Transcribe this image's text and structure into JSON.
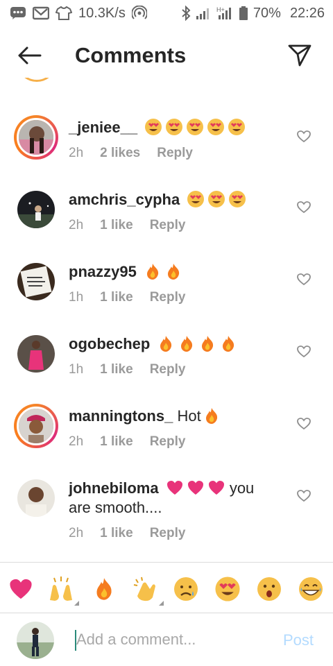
{
  "status_bar": {
    "speed": "10.3K/s",
    "battery": "70%",
    "time": "22:26",
    "network_label": "H+"
  },
  "header": {
    "title": "Comments",
    "back_icon": "arrow-left-icon",
    "share_icon": "paper-plane-icon"
  },
  "colors": {
    "story_ring": "#dd2a7b",
    "muted_text": "#9a9a9a",
    "post_disabled": "#b3dbff",
    "caret": "#2a8a7a"
  },
  "comments": [
    {
      "username": "_jeniee__",
      "text": "",
      "emojis": [
        "heart-eyes",
        "heart-eyes",
        "heart-eyes",
        "heart-eyes",
        "heart-eyes"
      ],
      "time": "2h",
      "likes": "2 likes",
      "reply": "Reply",
      "ring": true
    },
    {
      "username": "amchris_cypha",
      "text": "",
      "emojis": [
        "heart-eyes",
        "heart-eyes",
        "heart-eyes"
      ],
      "time": "2h",
      "likes": "1 like",
      "reply": "Reply",
      "ring": false
    },
    {
      "username": "pnazzy95",
      "text": "",
      "emojis": [
        "fire",
        "fire"
      ],
      "time": "1h",
      "likes": "1 like",
      "reply": "Reply",
      "ring": false
    },
    {
      "username": "ogobechep",
      "text": "",
      "emojis": [
        "fire",
        "fire",
        "fire",
        "fire"
      ],
      "time": "1h",
      "likes": "1 like",
      "reply": "Reply",
      "ring": false
    },
    {
      "username": "manningtons_",
      "text": "Hot",
      "emojis": [
        "fire"
      ],
      "time": "2h",
      "likes": "1 like",
      "reply": "Reply",
      "ring": true
    },
    {
      "username": "johnebiloma",
      "text_line1_after": "you",
      "text_line2": "are smooth....",
      "emojis": [
        "heart",
        "heart",
        "heart"
      ],
      "time": "2h",
      "likes": "1 like",
      "reply": "Reply",
      "ring": false
    }
  ],
  "quick_emojis": [
    "heart",
    "raised-hands",
    "fire",
    "clapping-hands",
    "sad-face",
    "heart-eyes",
    "surprised-face",
    "grinning-face"
  ],
  "composer": {
    "placeholder": "Add a comment...",
    "post_label": "Post"
  }
}
